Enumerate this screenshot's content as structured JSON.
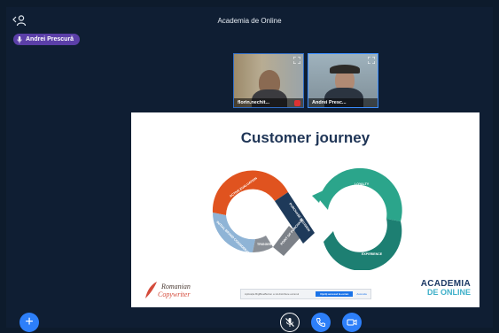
{
  "window": {
    "meeting_title": "Academia de Online",
    "back_users_icon": "users-back-icon"
  },
  "presenter": {
    "name": "Andrei Prescură",
    "icon": "mic-icon"
  },
  "participants": [
    {
      "name": "florin.nechit...",
      "state": "active-speaker",
      "icon": "expand-icon"
    },
    {
      "name": "Andrei Presc...",
      "state": "selected",
      "icon": "expand-icon"
    }
  ],
  "slide": {
    "title": "Customer journey",
    "segments": {
      "active_evaluation": "ACTIVE EVALUATION",
      "purchase_decision": "PURCHASE DECISION",
      "initial_brand_consideration": "INITIAL BRAND CONSIDERATION",
      "trigger": "TRIGGER",
      "point_of_purchase": "POINT OF PURCHASE",
      "loyalty": "LOYALTY",
      "experience": "EXPERIENCE"
    },
    "logo_left_line1": "Romanian",
    "logo_left_line2": "Copywriter",
    "logo_right_line1": "ACADEMIA",
    "logo_right_line2": "DE ONLINE",
    "share_bar": {
      "text": "Aplicația BigBlueButton a vă distribuie ecranul",
      "stop_label": "Opriți accesul la ecran",
      "hide_label": "Ascunde"
    }
  },
  "controls": {
    "add_icon": "plus-icon",
    "mute_icon": "mic-muted-icon",
    "phone_icon": "phone-icon",
    "camera_icon": "camera-icon"
  },
  "colors": {
    "background": "#0d1b2c",
    "badge": "#5b3fa8",
    "accent": "#2d7ff9",
    "orange": "#e0531f",
    "teal": "#2ba58b",
    "navy": "#1e3a5a",
    "light_blue": "#8fb4d6",
    "gray": "#8a8f96"
  }
}
